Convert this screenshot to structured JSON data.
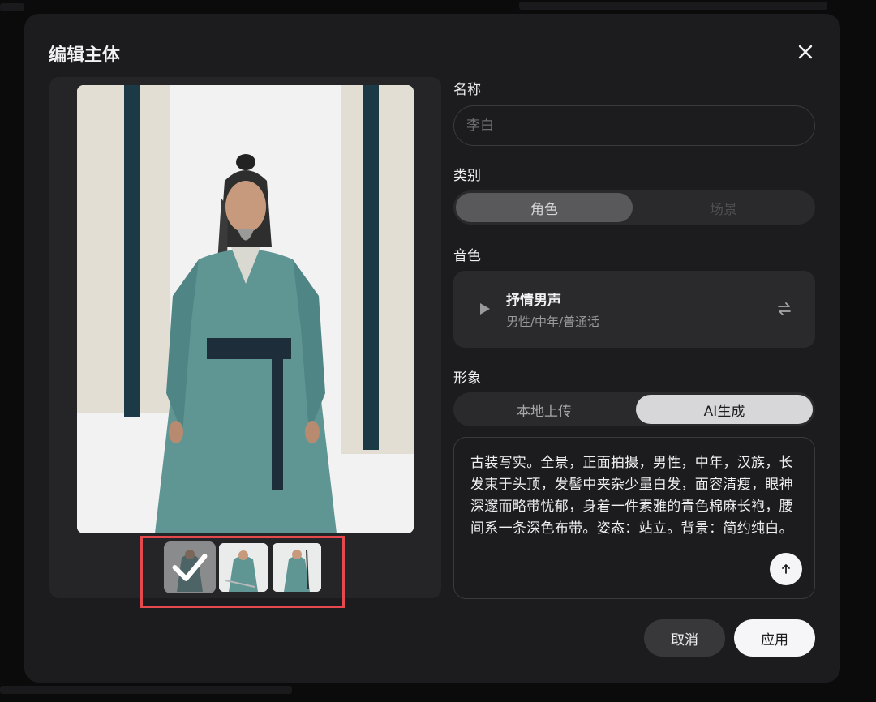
{
  "modal": {
    "title": "编辑主体",
    "close_icon": "close-icon"
  },
  "thumbnails": [
    {
      "name": "thumb-1",
      "selected": true
    },
    {
      "name": "thumb-2",
      "selected": false
    },
    {
      "name": "thumb-3",
      "selected": false
    }
  ],
  "form": {
    "name_label": "名称",
    "name_placeholder": "李白",
    "category_label": "类别",
    "category_options": [
      "角色",
      "场景"
    ],
    "category_selected": "角色",
    "voice_label": "音色",
    "voice": {
      "name": "抒情男声",
      "description": "男性/中年/普通话",
      "play_icon": "play-icon",
      "swap_icon": "swap-icon"
    },
    "image_label": "形象",
    "image_options": [
      "本地上传",
      "AI生成"
    ],
    "image_selected": "AI生成",
    "prompt": "古装写实。全景，正面拍摄，男性，中年，汉族，长发束于头顶，发髻中夹杂少量白发，面容清瘦，眼神深邃而略带忧郁，身着一件素雅的青色棉麻长袍，腰间系一条深色布带。姿态：站立。背景：简约纯白。",
    "send_icon": "arrow-up-icon"
  },
  "actions": {
    "cancel_label": "取消",
    "apply_label": "应用"
  },
  "colors": {
    "modal_bg": "#1c1c1e",
    "highlight_border": "#e5484d",
    "robe": "#5f9694",
    "sash": "#1e2d3a"
  }
}
